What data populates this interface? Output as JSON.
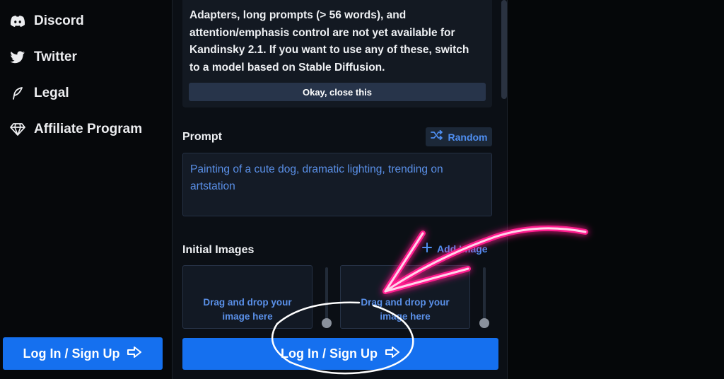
{
  "sidebar": {
    "items": [
      {
        "label": "Discord",
        "icon": "discord-icon"
      },
      {
        "label": "Twitter",
        "icon": "twitter-icon"
      },
      {
        "label": "Legal",
        "icon": "feather-icon"
      },
      {
        "label": "Affiliate Program",
        "icon": "diamond-icon"
      }
    ],
    "login_label": "Log In / Sign Up"
  },
  "notice": {
    "lines": [
      "Adapters, long prompts (> 56 words), and",
      "attention/emphasis control are not yet available for",
      "Kandinsky 2.1. If you want to use any of these, switch",
      "to a model based on Stable Diffusion."
    ],
    "close_label": "Okay, close this"
  },
  "prompt": {
    "title": "Prompt",
    "random_label": "Random",
    "text": "Painting of a cute dog, dramatic lighting, trending on artstation"
  },
  "initial_images": {
    "title": "Initial Images",
    "add_label": "Add Image",
    "dropzones": [
      {
        "label": "Drag and drop your image here"
      },
      {
        "label": "Drag and drop your image here"
      }
    ]
  },
  "main": {
    "login_label": "Log In / Sign Up"
  },
  "colors": {
    "accent": "#1570ef",
    "link_blue": "#4f8ff2",
    "annotation_pink": "#ff1f8e",
    "background": "#050709"
  }
}
